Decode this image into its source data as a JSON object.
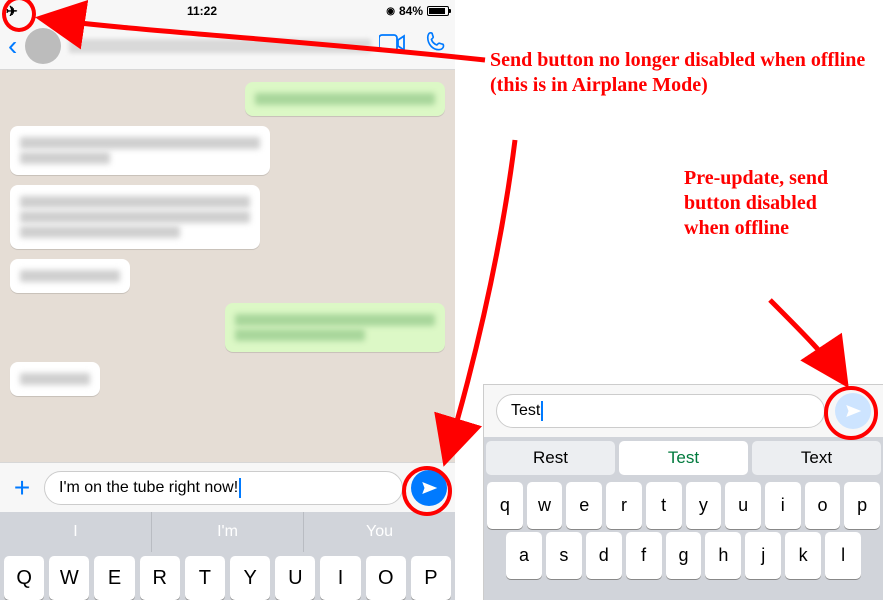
{
  "status": {
    "time": "11:22",
    "battery_pct": "84%"
  },
  "nav": {
    "video_icon": "video-icon",
    "call_icon": "phone-icon"
  },
  "left": {
    "input_value": "I'm on the tube right now!",
    "suggestions": [
      "I",
      "I'm",
      "You"
    ],
    "keys_row1": [
      "Q",
      "W",
      "E",
      "R",
      "T",
      "Y",
      "U",
      "I",
      "O",
      "P"
    ]
  },
  "right": {
    "input_value": "Test",
    "suggestions": [
      "Rest",
      "Test",
      "Text"
    ],
    "keys_row1": [
      "q",
      "w",
      "e",
      "r",
      "t",
      "y",
      "u",
      "i",
      "o",
      "p"
    ],
    "keys_row2": [
      "a",
      "s",
      "d",
      "f",
      "g",
      "h",
      "j",
      "k",
      "l"
    ]
  },
  "annotations": {
    "main": "Send button no longer disabled when offline (this is in Airplane Mode)",
    "side": "Pre-update, send button disabled when offline"
  }
}
